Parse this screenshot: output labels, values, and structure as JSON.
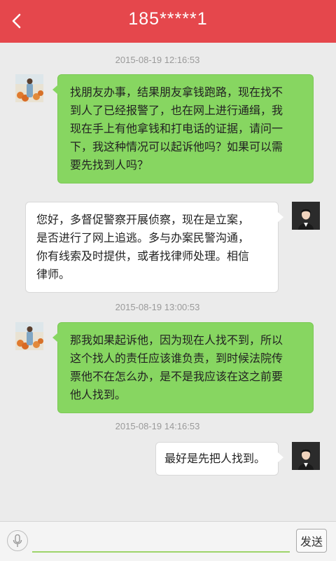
{
  "header": {
    "title": "185*****1",
    "back_icon": "chevron-left-icon",
    "background": "#e5474c"
  },
  "conversation": {
    "timestamps": [
      "2015-08-19  12:16:53",
      "2015-08-19  13:00:53",
      "2015-08-19  14:16:53"
    ],
    "messages": [
      {
        "sender": "user",
        "lines": [
          "找朋友办事，结果朋友拿钱跑路，现在找不",
          "到人了已经报警了，也在网上进行通缉，我",
          "现在手上有他拿钱和打电话的证据，请问一",
          "下，我这种情况可以起诉他吗？如果可以需",
          "要先找到人吗？"
        ]
      },
      {
        "sender": "lawyer",
        "lines": [
          "您好，多督促警察开展侦察，现在是立案，",
          "是否进行了网上追逃。多与办案民警沟通，",
          "你有线索及时提供，或者找律师处理。相信",
          "律师。"
        ]
      },
      {
        "sender": "user",
        "lines": [
          "那我如果起诉他，因为现在人找不到，所以",
          "这个找人的责任应该谁负责，到时候法院传",
          "票他不在怎么办，是不是我应该在这之前要",
          "他人找到。"
        ]
      },
      {
        "sender": "lawyer",
        "lines": [
          "最好是先把人找到。"
        ]
      }
    ],
    "user_bubble_color": "#87d661",
    "lawyer_bubble_color": "#ffffff"
  },
  "footer": {
    "mic_icon": "microphone-icon",
    "input_value": "",
    "send_label": "发送",
    "input_underline_color": "#9ed46a"
  }
}
